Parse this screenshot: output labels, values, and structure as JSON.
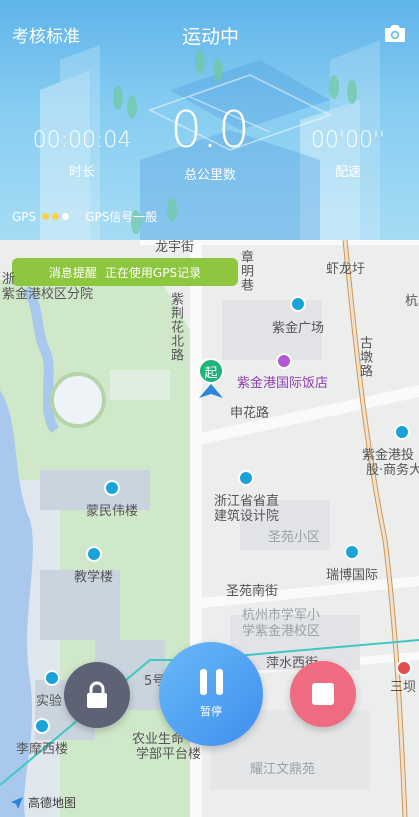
{
  "header": {
    "left_label": "考核标准",
    "title": "运动中",
    "camera_icon": "camera-icon",
    "duration": {
      "value": "00:00:04",
      "label": "时长"
    },
    "distance": {
      "value": "0.0",
      "label": "总公里数"
    },
    "pace": {
      "value": "00'00''",
      "label": "配速"
    },
    "gps": {
      "label": "GPS",
      "signal_text": "GPS信号一般",
      "signal_level": 2,
      "signal_max": 3
    }
  },
  "map": {
    "banner": {
      "title": "消息提醒",
      "text": "正在使用GPS记录"
    },
    "labels": {
      "longyu": "龙宇街",
      "zhangming": "章明巷",
      "xialong": "虾龙圩",
      "zijingang_hosp": "浙",
      "zijingang_hosp2": "紫金港校区分院",
      "zijinghua": "紫荆花北路",
      "zijin_square": "紫金广场",
      "hang": "杭",
      "gudun": "古墩路",
      "hotel": "紫金港国际饭店",
      "shenhua": "申花路",
      "zjg_share": "紫金港投",
      "zjg_share2": "股·商务大",
      "mengmin": "蒙民伟楼",
      "arch": "浙江省省直",
      "arch2": "建筑设计院",
      "shengyuan": "圣苑小区",
      "ruibo": "瑞博国际",
      "teaching": "教学楼",
      "shengyuan_south": "圣苑南街",
      "xuejun": "杭州市学军小",
      "xuejun2": "学紫金港校区",
      "pingshui": "萍水西街",
      "sanba": "三坝",
      "lab": "实验",
      "metro5": "5号",
      "limo": "李摩西楼",
      "agri": "农业生命",
      "agri2": "学部平台楼",
      "yaojiang": "耀江文鼎苑"
    },
    "attribution": "高德地图"
  },
  "controls": {
    "lock_icon": "lock-icon",
    "pause_label": "暂停",
    "stop_icon": "stop-icon"
  },
  "colors": {
    "banner": "#8dc63f",
    "pause": "#4a9cf2",
    "lock": "#5d6275",
    "stop": "#ee6b82",
    "gps_dot": "#f7d24a"
  }
}
